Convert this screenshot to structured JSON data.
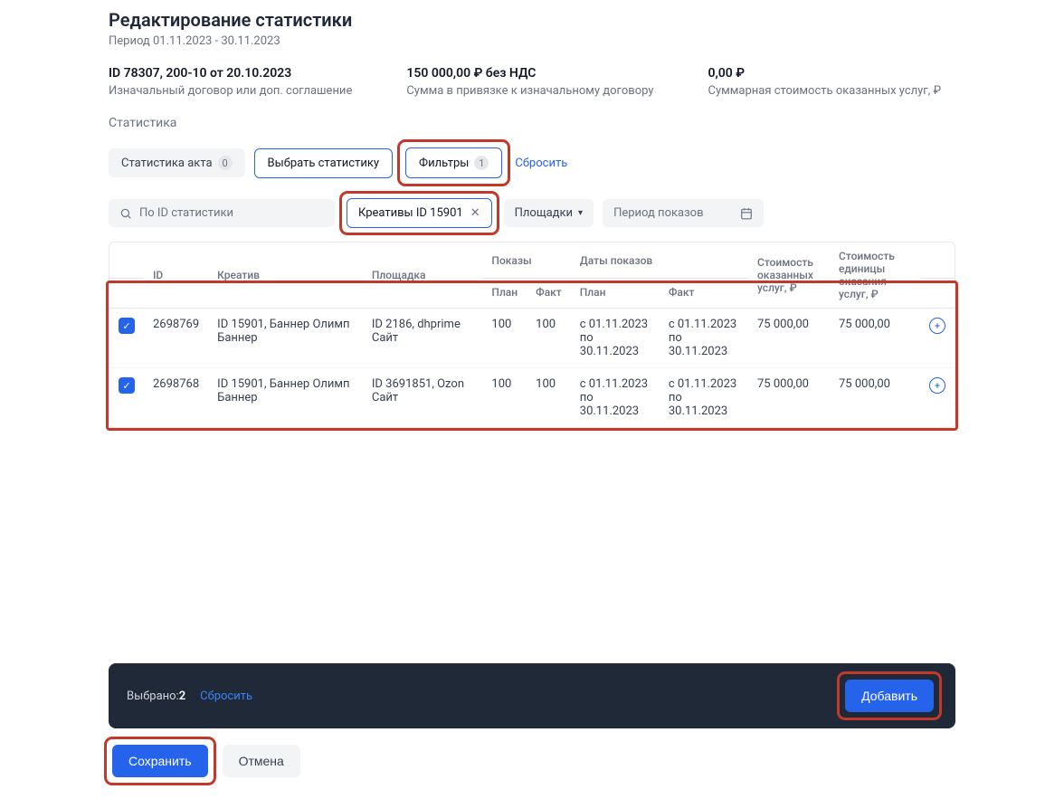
{
  "page": {
    "title": "Редактирование статистики",
    "period": "Период 01.11.2023 - 30.11.2023"
  },
  "summary": {
    "contract_id": "ID 78307, 200-10 от 20.10.2023",
    "contract_label": "Изначальный договор или доп. соглашение",
    "sum_val": "150 000,00 ₽ без НДС",
    "sum_label": "Сумма в привязке к изначальному договору",
    "total_val": "0,00 ₽",
    "total_label": "Суммарная стоимость оказанных услуг, ₽"
  },
  "stats": {
    "section_title": "Статистика",
    "act_stats_label": "Статистика акта",
    "act_stats_count": "0",
    "select_stats": "Выбрать статистику",
    "filters_label": "Фильтры",
    "filters_count": "1",
    "reset": "Сбросить"
  },
  "filters": {
    "search_placeholder": "По ID статистики",
    "creative_chip": "Креативы ID 15901",
    "sites_label": "Площадки",
    "period_label": "Период показов"
  },
  "table": {
    "headers": {
      "id": "ID",
      "creative": "Креатив",
      "site": "Площадка",
      "impressions": "Показы",
      "plan": "План",
      "fact": "Факт",
      "dates": "Даты показов",
      "dates_plan": "План",
      "dates_fact": "Факт",
      "cost_services": "Стоимость оказанных услуг, ₽",
      "cost_unit": "Стоимость единицы оказания услуг, ₽"
    },
    "rows": [
      {
        "id": "2698769",
        "creative": "ID 15901, Баннер Олимп Баннер",
        "site": "ID 2186, dhprime Сайт",
        "plan": "100",
        "fact": "100",
        "date_plan_from": "с 01.11.2023",
        "date_plan_to": "по 30.11.2023",
        "date_fact_from": "с 01.11.2023",
        "date_fact_to": "по 30.11.2023",
        "cost_services": "75 000,00",
        "cost_unit": "75 000,00"
      },
      {
        "id": "2698768",
        "creative": "ID 15901, Баннер Олимп Баннер",
        "site": "ID 3691851, Ozon Сайт",
        "plan": "100",
        "fact": "100",
        "date_plan_from": "с 01.11.2023",
        "date_plan_to": "по 30.11.2023",
        "date_fact_from": "с 01.11.2023",
        "date_fact_to": "по 30.11.2023",
        "cost_services": "75 000,00",
        "cost_unit": "75 000,00"
      }
    ]
  },
  "selection": {
    "label": "Выбрано:",
    "count": "2",
    "reset": "Сбросить",
    "add": "Добавить"
  },
  "actions": {
    "save": "Сохранить",
    "cancel": "Отмена"
  }
}
